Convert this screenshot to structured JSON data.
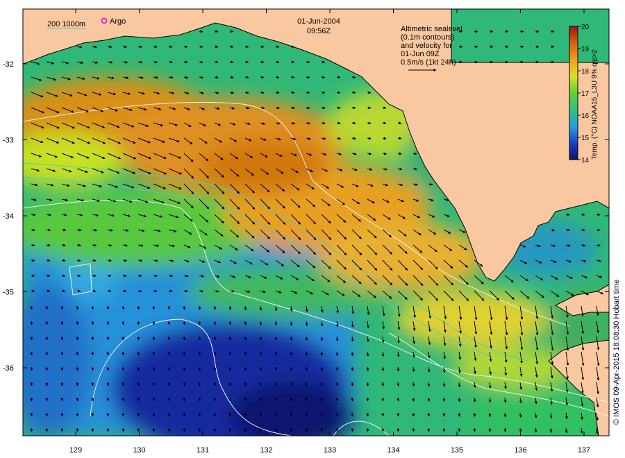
{
  "header": {
    "date": "01-Jun-2004",
    "time": "09:56Z"
  },
  "legend": {
    "isobath_label": "200  1000m",
    "argo_label": "Argo",
    "isobath_color": "#40d0c8",
    "argo_color": "#e000e0"
  },
  "note": {
    "lines": [
      "Altimetric sealevel",
      "(0.1m contours)",
      "and velocity for",
      "01-Jun 09Z",
      "0.5m/s (1kt 24h)"
    ]
  },
  "colorbar": {
    "title": "Temp. (°C) NOAA15_L3U 9% qlp>2",
    "min": 14,
    "max": 20,
    "ticks": [
      "14",
      "15",
      "16",
      "17",
      "18",
      "19",
      "20"
    ],
    "stops": [
      "#10106a",
      "#1840c8",
      "#28a0e0",
      "#30c080",
      "#60d030",
      "#d8e020",
      "#f0a020",
      "#d86010",
      "#a01808"
    ]
  },
  "axes": {
    "lon_ticks": [
      "129",
      "130",
      "131",
      "132",
      "133",
      "134",
      "135",
      "136",
      "137"
    ],
    "lat_ticks": [
      "-32",
      "-33",
      "-34",
      "-35",
      "-36"
    ]
  },
  "credit": "© IMOS 09-Apr-2015 18:08:30 Hobart time",
  "colors": {
    "land": "#fac8a0",
    "coast": "#000000",
    "contour": "#f0f0f0"
  }
}
